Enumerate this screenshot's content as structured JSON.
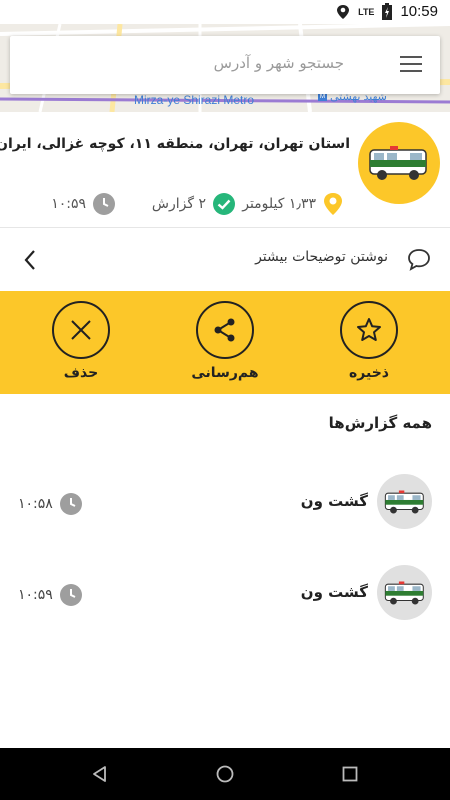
{
  "status_bar": {
    "network": "LTE",
    "time": "10:59"
  },
  "map": {
    "metro_label": "Mirza-ye Shirazi Metro",
    "station_label": "شهید بهشتی",
    "road_color": "#fde7a1",
    "route_color": "#9b7bd3"
  },
  "search": {
    "placeholder": "جستجو شهر و آدرس"
  },
  "location": {
    "address": "استان تهران، تهران، منطقه ۱۱، کوچه غزالی، ایران",
    "distance": "۱٫۳۳ کیلومتر",
    "reports_count": "۲ گزارش",
    "time": "۱۰:۵۹"
  },
  "more_details": {
    "label": "نوشتن توضیحات بیشتر"
  },
  "actions": {
    "save": "ذخیره",
    "share": "هم‌رسانی",
    "delete": "حذف"
  },
  "reports": {
    "title": "همه گزارش‌ها",
    "items": [
      {
        "name": "گشت ون",
        "time": "۱۰:۵۸"
      },
      {
        "name": "گشت ون",
        "time": "۱۰:۵۹"
      }
    ]
  },
  "colors": {
    "accent": "#fcc729",
    "check_green": "#26b67a",
    "icon_gray": "#9e9e9e"
  },
  "icons": {
    "wifi": "wifi-icon",
    "battery": "battery-icon",
    "menu": "menu-icon",
    "location": "location-pin-icon",
    "check": "check-circle-icon",
    "clock": "clock-icon",
    "comment": "comment-icon",
    "chevron": "chevron-left-icon",
    "star": "star-icon",
    "share": "share-icon",
    "close": "close-icon",
    "van": "police-van-icon"
  }
}
